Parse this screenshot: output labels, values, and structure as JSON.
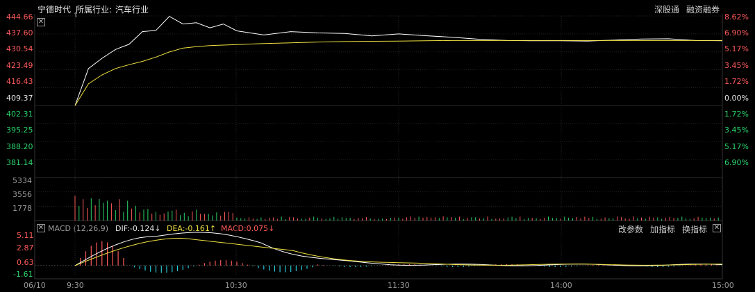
{
  "header": {
    "stock_name": "宁德时代",
    "industry_label": "所属行业:",
    "industry_value": "汽车行业",
    "link_1": "深股通",
    "link_2": "融资融券"
  },
  "price_axis": {
    "left": [
      "444.66",
      "437.60",
      "430.54",
      "423.49",
      "416.43",
      "409.37",
      "402.31",
      "395.25",
      "388.20",
      "381.14"
    ],
    "right": [
      "8.62%",
      "6.90%",
      "5.17%",
      "3.45%",
      "1.72%",
      "0.00%",
      "1.72%",
      "3.45%",
      "5.17%",
      "6.90%"
    ]
  },
  "volume_axis": [
    "5334",
    "3556",
    "1778"
  ],
  "macd_panel": {
    "title": "MACD (12,26,9)",
    "dif_text": "DIF:-0.124↓",
    "dea_text": "DEA:-0.161↑",
    "macd_text": "MACD:0.075↓",
    "axis": [
      "5.11",
      "2.87",
      "0.63",
      "-1.61"
    ],
    "btn_params": "改参数",
    "btn_add": "加指标",
    "btn_switch": "换指标",
    "close_glyph": "✕"
  },
  "time_axis": [
    "06/10",
    "9:30",
    "10:30",
    "11:30",
    "14:00",
    "15:00"
  ],
  "colors": {
    "background": "#000000",
    "price_line": "#ffffff",
    "avg_line": "#f0e040",
    "up": "#ff5a5a",
    "down": "#2bd46a",
    "macd_neg": "#29c9d6",
    "grid": "#222222"
  },
  "chart_data": {
    "type": "line",
    "title": "宁德时代",
    "prev_close": 409.37,
    "x_range": [
      "9:30",
      "15:00"
    ],
    "ylim": [
      381.14,
      444.66
    ],
    "series": [
      {
        "x": [
          "9:30",
          "9:35",
          "9:40",
          "9:45",
          "9:50",
          "9:55",
          "10:00",
          "10:05",
          "10:10",
          "10:15",
          "10:20",
          "10:25",
          "10:30",
          "10:40",
          "10:50",
          "11:00",
          "11:10",
          "11:20",
          "11:30",
          "13:10",
          "13:20",
          "13:30",
          "13:40",
          "13:50",
          "14:00",
          "14:10",
          "14:20",
          "14:30",
          "14:40",
          "14:50",
          "15:00"
        ],
        "values": [
          409.4,
          424.0,
          428.0,
          431.5,
          433.5,
          438.5,
          439.0,
          444.5,
          441.5,
          442.0,
          440.0,
          441.5,
          438.8,
          437.2,
          438.5,
          438.0,
          437.8,
          436.8,
          437.6,
          436.9,
          436.3,
          435.5,
          435.0,
          434.9,
          434.9,
          434.8,
          435.2,
          435.6,
          435.7,
          435.0,
          434.9
        ]
      },
      {
        "x": [
          "9:30",
          "9:35",
          "9:40",
          "9:45",
          "9:50",
          "9:55",
          "10:00",
          "10:05",
          "10:10",
          "10:15",
          "10:20",
          "10:25",
          "10:30",
          "10:40",
          "10:50",
          "11:00",
          "11:10",
          "11:20",
          "11:30",
          "13:10",
          "13:20",
          "13:30",
          "13:40",
          "13:50",
          "14:00",
          "14:10",
          "14:20",
          "14:30",
          "14:40",
          "14:50",
          "15:00"
        ],
        "values": [
          409.4,
          418.0,
          421.5,
          424.0,
          425.5,
          426.8,
          428.5,
          430.5,
          432.0,
          432.6,
          433.0,
          433.2,
          433.4,
          433.8,
          434.1,
          434.4,
          434.6,
          434.7,
          434.8,
          434.9,
          435.0,
          435.0,
          435.0,
          435.0,
          435.0,
          435.0,
          435.0,
          435.0,
          435.0,
          435.0,
          435.0
        ]
      }
    ],
    "volume": {
      "ylim": [
        0,
        5334
      ],
      "note_levels": [
        1778,
        3556,
        5334
      ]
    },
    "macd": {
      "params": [
        12,
        26,
        9
      ],
      "dif": -0.124,
      "dea": -0.161,
      "macd": 0.075,
      "ylim": [
        -1.61,
        5.11
      ]
    }
  }
}
